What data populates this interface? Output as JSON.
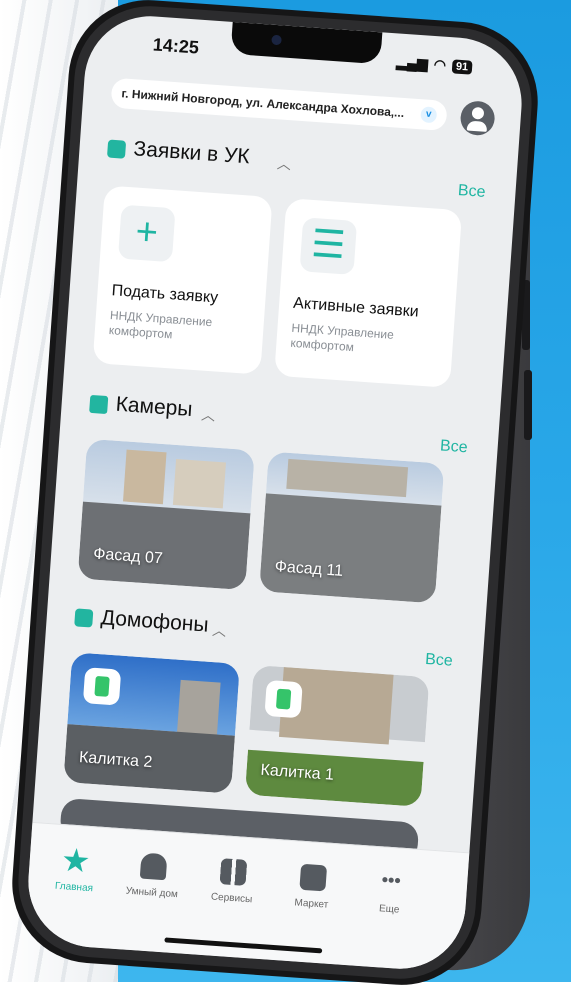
{
  "status": {
    "time": "14:25",
    "battery": "91"
  },
  "address": {
    "text": "г. Нижний Новгород, ул. Александра Хохлова,...",
    "chevron": "v"
  },
  "requests": {
    "title": "Заявки в УК",
    "all": "Все",
    "cards": [
      {
        "title": "Подать заявку",
        "subtitle": "ННДК Управление комфортом",
        "icon": "plus-icon"
      },
      {
        "title": "Активные заявки",
        "subtitle": "ННДК Управление комфортом",
        "icon": "list-icon"
      }
    ]
  },
  "cameras": {
    "title": "Камеры",
    "all": "Все",
    "items": [
      {
        "label": "Фасад 07"
      },
      {
        "label": "Фасад 11"
      }
    ]
  },
  "intercoms": {
    "title": "Домофоны",
    "all": "Все",
    "items": [
      {
        "label": "Калитка 2"
      },
      {
        "label": "Калитка 1"
      }
    ]
  },
  "tabs": [
    {
      "label": "Главная",
      "icon": "star-icon"
    },
    {
      "label": "Умный дом",
      "icon": "house-icon"
    },
    {
      "label": "Сервисы",
      "icon": "grid-icon"
    },
    {
      "label": "Маркет",
      "icon": "bag-icon"
    },
    {
      "label": "Еще",
      "icon": "more-icon"
    }
  ],
  "colors": {
    "accent": "#1fb5a2",
    "background": "#29a7e8"
  }
}
